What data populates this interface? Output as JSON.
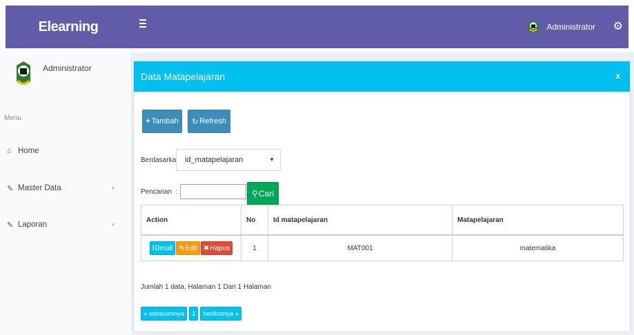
{
  "app": {
    "brand": "Elearning"
  },
  "header": {
    "user_name": "Administrator"
  },
  "sidebar": {
    "user_name": "Administrator",
    "menu_header": "Menu",
    "items": [
      {
        "label": "Home",
        "icon": "home-icon"
      },
      {
        "label": "Master Data",
        "icon": "edit-icon",
        "chevron": "‹"
      },
      {
        "label": "Laporan",
        "icon": "edit-icon",
        "chevron": "‹"
      }
    ]
  },
  "box": {
    "title": "Data Matapelajaran",
    "close": "x",
    "tambah": "Tambah",
    "refresh": "Refresh"
  },
  "filter": {
    "by_label": "Berdasarkan:",
    "by_value": "id_matapelajaran",
    "search_label": "Pencarian",
    "search_colon": ":",
    "search_value": "",
    "search_button": "Cari"
  },
  "table": {
    "headers": [
      "Action",
      "No",
      "Id matapelajaran",
      "Matapelajaran"
    ],
    "rows": [
      {
        "no": "1",
        "id": "MAT001",
        "name": "matematika"
      }
    ],
    "actions": {
      "detail": "Detail",
      "edit": "Edit",
      "hapus": "Hapus"
    }
  },
  "summary": "Jumlah 1 data, Halaman 1 Dari 1 Halaman",
  "pagination": {
    "prev": "« sebelumnya",
    "page": "1",
    "next": "berikutnya »"
  },
  "colors": {
    "header_bg": "#605ca8",
    "box_header": "#00c0ef",
    "primary": "#3c8dbc",
    "success": "#00a65a",
    "info": "#00c0ef",
    "warning": "#f39c12",
    "danger": "#dd4b39"
  }
}
